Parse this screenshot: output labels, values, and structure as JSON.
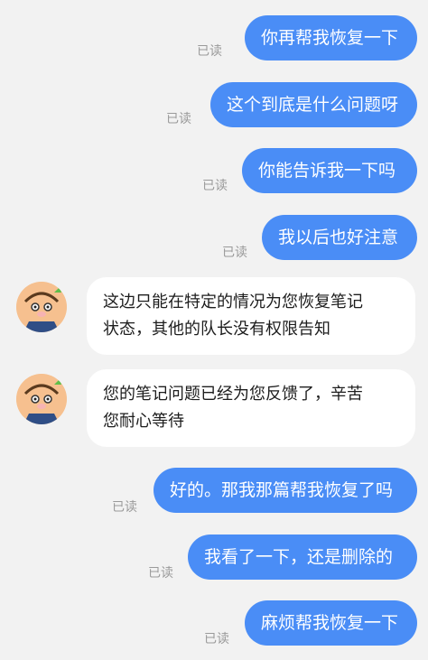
{
  "messages": [
    {
      "text": "你再帮我恢复一下",
      "status": "已读"
    },
    {
      "text": "这个到底是什么问题呀",
      "status": "已读"
    },
    {
      "text": "你能告诉我一下吗",
      "status": "已读"
    },
    {
      "text": "我以后也好注意",
      "status": "已读"
    },
    {
      "text": "这边只能在特定的情况为您恢复笔记\n状态，其他的队长没有权限告知"
    },
    {
      "text": "您的笔记问题已经为您反馈了，辛苦\n您耐心等待"
    },
    {
      "text": "好的。那我那篇帮我恢复了吗",
      "status": "已读"
    },
    {
      "text": "我看了一下，还是删除的",
      "status": "已读"
    },
    {
      "text": "麻烦帮我恢复一下",
      "status": "已读"
    }
  ],
  "colors": {
    "outgoing_bubble": "#4a8df6",
    "incoming_bubble": "#ffffff",
    "background": "#f2f2f2",
    "read_text": "#9a9a9a"
  },
  "icons": {
    "avatar": "cartoon-avatar-icon"
  }
}
